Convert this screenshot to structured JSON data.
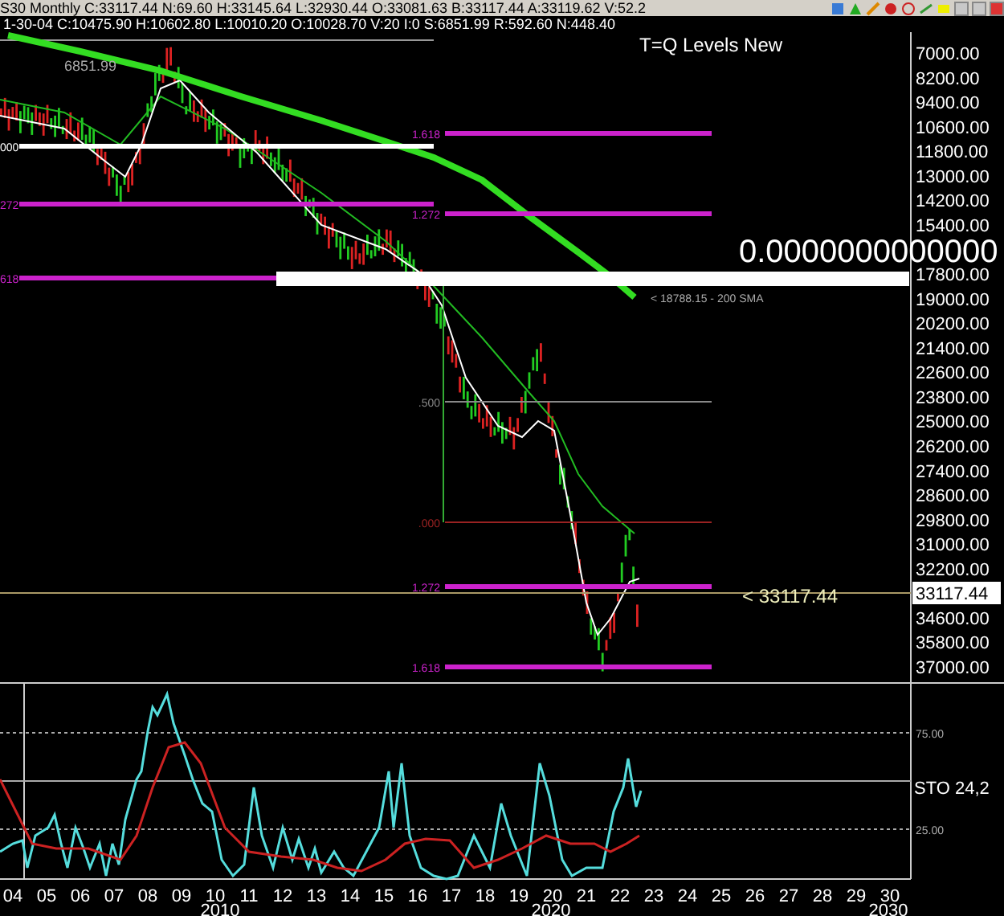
{
  "title_bar": {
    "title": "S30 Monthly C:33117.44 N:69.60 H:33145.64 L:32930.44 O:33081.63 B:33117.44 A:33119.62 V:52.2"
  },
  "info_line": "1-30-04 C:10475.90 H:10602.80 L:10010.20 O:10028.70 V:20 I:0 S:6851.99 R:592.60 N:448.40",
  "chart": {
    "title": "T=Q Levels New",
    "high_label": "6851.99",
    "overlay_value": "0.0000000000000",
    "sma_label": "<  18788.15 - 200 SMA",
    "price_axis": [
      "7000.00",
      "8200.00",
      "9400.00",
      "10600.00",
      "11800.00",
      "13000.00",
      "14200.00",
      "15400.00",
      "17800.00",
      "19000.00",
      "20200.00",
      "21400.00",
      "22600.00",
      "23800.00",
      "25000.00",
      "26200.00",
      "27400.00",
      "28600.00",
      "29800.00",
      "31000.00",
      "32200.00",
      "34600.00",
      "35800.00",
      "37000.00"
    ],
    "current_price": {
      "axis_label": "33117.44",
      "marker": "< 33117.44"
    },
    "left_levels": [
      {
        "label": "000",
        "color": "#ffffff"
      },
      {
        "label": "272",
        "color": "#cc22cc"
      },
      {
        "label": "618",
        "color": "#cc22cc"
      }
    ],
    "fib_levels": [
      {
        "label": "1.618",
        "color": "#cc22cc"
      },
      {
        "label": "1.272",
        "color": "#cc22cc"
      },
      {
        "label": ".500",
        "color": "#888888"
      },
      {
        "label": ".000",
        "color": "#992222"
      },
      {
        "label": "1.272",
        "color": "#cc22cc"
      },
      {
        "label": "1.618",
        "color": "#cc22cc"
      }
    ]
  },
  "indicator": {
    "label": "STO  24,2",
    "ticks": [
      "75.00",
      "25.00"
    ]
  },
  "time_axis": {
    "years": [
      "04",
      "05",
      "06",
      "07",
      "08",
      "09",
      "10",
      "11",
      "12",
      "13",
      "14",
      "15",
      "16",
      "17",
      "18",
      "19",
      "20",
      "21",
      "22",
      "23",
      "24",
      "25",
      "26",
      "27",
      "28",
      "29",
      "30"
    ],
    "decades": [
      "2010",
      "2020",
      "2030"
    ]
  }
}
